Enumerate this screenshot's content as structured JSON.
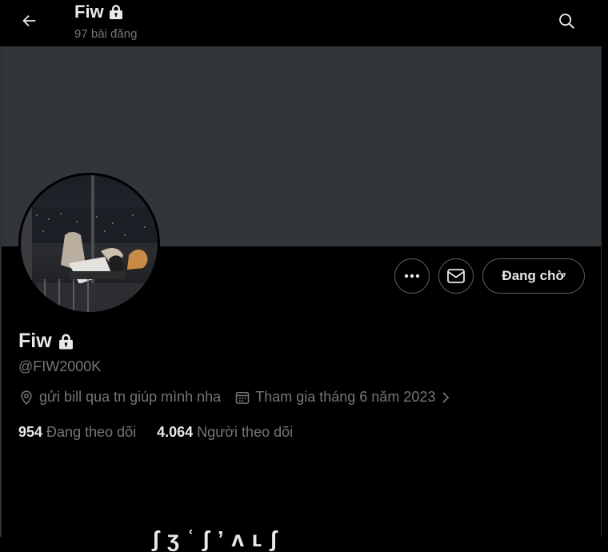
{
  "header": {
    "title": "Fiw",
    "post_count": "97 bài đăng"
  },
  "actions": {
    "pending_label": "Đang chờ"
  },
  "profile": {
    "display_name": "Fiw",
    "handle": "@FIW2000K",
    "location": "gửi bill qua tn giúp mình nha",
    "joined": "Tham gia tháng 6 năm 2023",
    "following_count": "954",
    "following_label": "Đang theo dõi",
    "followers_count": "4.064",
    "followers_label": "Người theo dõi"
  },
  "bottom": {
    "partial_text": "ʃ ʒ ʿ ʃ ʼ   ʌ ʟ    ʃ"
  },
  "colors": {
    "background": "#000000",
    "banner": "#333639",
    "text_primary": "#e7e9ea",
    "text_secondary": "#71767b",
    "border": "#536471"
  },
  "icons": [
    "back-arrow-icon",
    "lock-icon",
    "search-icon",
    "more-icon",
    "mail-icon",
    "location-icon",
    "calendar-icon",
    "chevron-right-icon"
  ]
}
